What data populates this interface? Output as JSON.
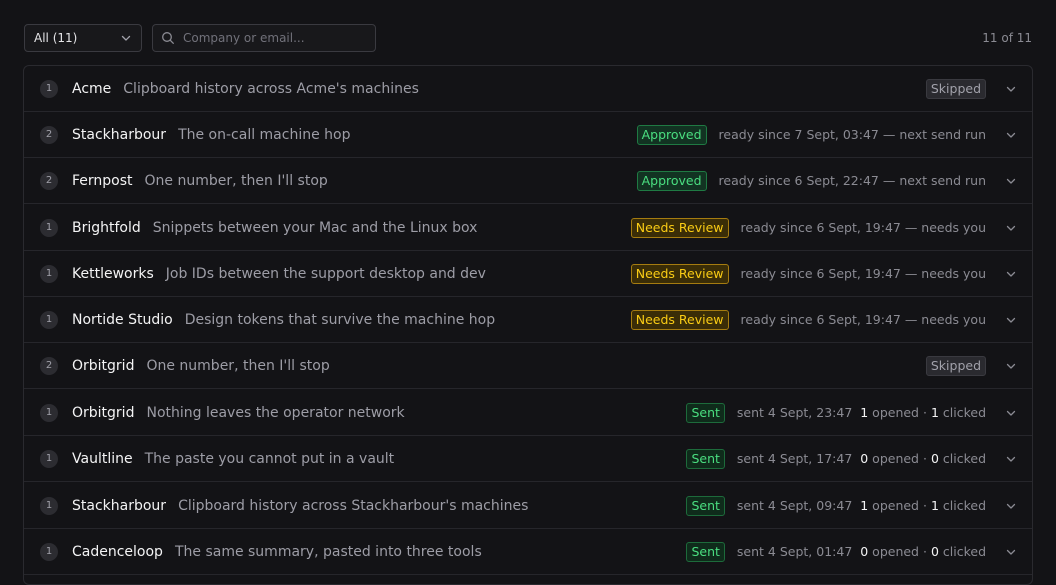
{
  "toolbar": {
    "filter_label": "All (11)",
    "search_placeholder": "Company or email...",
    "count_label": "11 of 11"
  },
  "rows": [
    {
      "num": "1",
      "company": "Acme",
      "subject": "Clipboard history across Acme's machines",
      "status": "Skipped",
      "status_kind": "skipped",
      "meta": ""
    },
    {
      "num": "2",
      "company": "Stackharbour",
      "subject": "The on-call machine hop",
      "status": "Approved",
      "status_kind": "approved",
      "meta": "ready since 7 Sept, 03:47 — next send run"
    },
    {
      "num": "2",
      "company": "Fernpost",
      "subject": "One number, then I'll stop",
      "status": "Approved",
      "status_kind": "approved",
      "meta": "ready since 6 Sept, 22:47 — next send run"
    },
    {
      "num": "1",
      "company": "Brightfold",
      "subject": "Snippets between your Mac and the Linux box",
      "status": "Needs Review",
      "status_kind": "review",
      "meta": "ready since 6 Sept, 19:47 — needs you"
    },
    {
      "num": "1",
      "company": "Kettleworks",
      "subject": "Job IDs between the support desktop and dev",
      "status": "Needs Review",
      "status_kind": "review",
      "meta": "ready since 6 Sept, 19:47 — needs you"
    },
    {
      "num": "1",
      "company": "Nortide Studio",
      "subject": "Design tokens that survive the machine hop",
      "status": "Needs Review",
      "status_kind": "review",
      "meta": "ready since 6 Sept, 19:47 — needs you"
    },
    {
      "num": "2",
      "company": "Orbitgrid",
      "subject": "One number, then I'll stop",
      "status": "Skipped",
      "status_kind": "skipped",
      "meta": ""
    },
    {
      "num": "1",
      "company": "Orbitgrid",
      "subject": "Nothing leaves the operator network",
      "status": "Sent",
      "status_kind": "sent",
      "meta": "sent 4 Sept, 23:47",
      "opened": "1",
      "clicked": "1"
    },
    {
      "num": "1",
      "company": "Vaultline",
      "subject": "The paste you cannot put in a vault",
      "status": "Sent",
      "status_kind": "sent",
      "meta": "sent 4 Sept, 17:47",
      "opened": "0",
      "clicked": "0"
    },
    {
      "num": "1",
      "company": "Stackharbour",
      "subject": "Clipboard history across Stackharbour's machines",
      "status": "Sent",
      "status_kind": "sent",
      "meta": "sent 4 Sept, 09:47",
      "opened": "1",
      "clicked": "1"
    },
    {
      "num": "1",
      "company": "Cadenceloop",
      "subject": "The same summary, pasted into three tools",
      "status": "Sent",
      "status_kind": "sent",
      "meta": "sent 4 Sept, 01:47",
      "opened": "0",
      "clicked": "0"
    }
  ],
  "labels": {
    "opened": "opened",
    "clicked": "clicked",
    "separator": "·"
  },
  "icons": {
    "filter": "chevron-down-icon",
    "search": "search-icon",
    "expand": "chevron-down-icon"
  }
}
